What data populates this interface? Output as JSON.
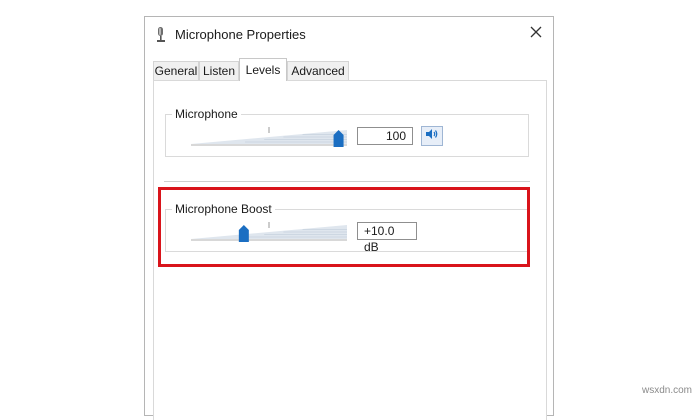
{
  "window": {
    "title": "Microphone Properties",
    "close_glyph": "✕"
  },
  "tabs": [
    {
      "label": "General",
      "active": false
    },
    {
      "label": "Listen",
      "active": false
    },
    {
      "label": "Levels",
      "active": true
    },
    {
      "label": "Advanced",
      "active": false
    }
  ],
  "levels": {
    "microphone": {
      "label": "Microphone",
      "value_text": "100",
      "level_fraction": 1.0,
      "mute_icon": "speaker-icon"
    },
    "boost": {
      "label": "Microphone Boost",
      "value_text": "+10.0 dB",
      "level_fraction": 0.33
    }
  },
  "colors": {
    "highlight": "#d9141b",
    "thumb": "#1b6ec2"
  },
  "watermark": "wsxdn.com"
}
